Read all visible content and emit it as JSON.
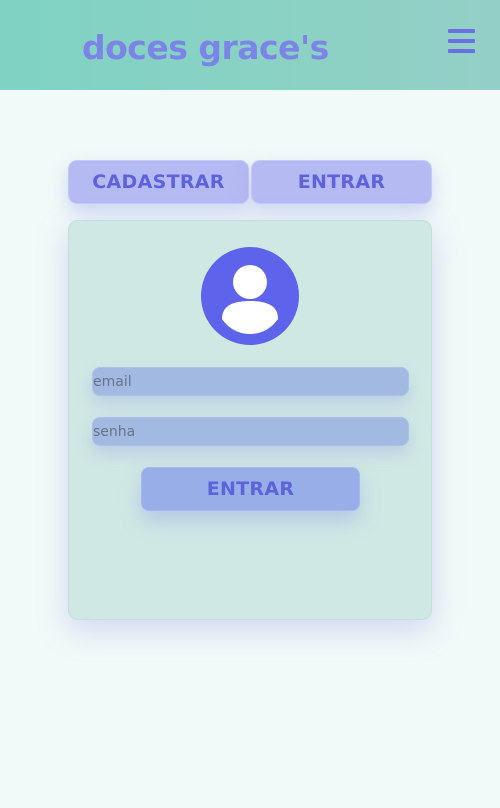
{
  "header": {
    "brand": "doces grace's",
    "menu_icon": "hamburger-menu-icon"
  },
  "tabs": [
    {
      "label": "CADASTRAR"
    },
    {
      "label": "ENTRAR"
    }
  ],
  "login": {
    "avatar_icon": "user-avatar-icon",
    "email_placeholder": "email",
    "password_placeholder": "senha",
    "submit_label": "ENTRAR"
  },
  "colors": {
    "accent": "#5e63dc",
    "header_bg": "#8dd1c4",
    "card_bg": "#d0e8e4"
  }
}
